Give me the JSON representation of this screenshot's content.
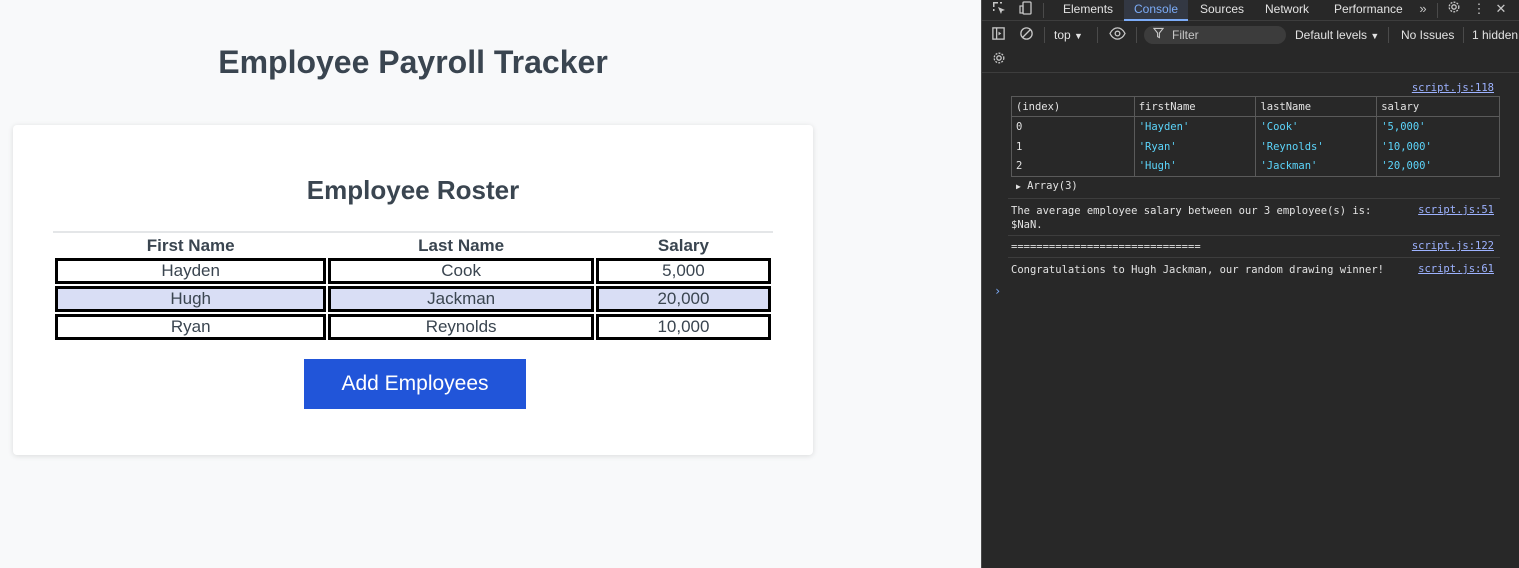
{
  "app": {
    "title": "Employee Payroll Tracker",
    "card_title": "Employee Roster",
    "table": {
      "headers": [
        "First Name",
        "Last Name",
        "Salary"
      ],
      "rows": [
        {
          "first": "Hayden",
          "last": "Cook",
          "salary": "5,000"
        },
        {
          "first": "Hugh",
          "last": "Jackman",
          "salary": "20,000"
        },
        {
          "first": "Ryan",
          "last": "Reynolds",
          "salary": "10,000"
        }
      ]
    },
    "add_button_label": "Add Employees"
  },
  "devtools": {
    "tabs": [
      "Elements",
      "Console",
      "Sources",
      "Network",
      "Performance"
    ],
    "active_tab": "Console",
    "more_tabs_icon": "chevron-double-right-icon",
    "toolbar": {
      "context": "top",
      "filter_placeholder": "Filter",
      "levels": "Default levels",
      "issues": "No Issues",
      "hidden": "1 hidden"
    },
    "console": {
      "table_source": "script.js:118",
      "table_headers": [
        "(index)",
        "firstName",
        "lastName",
        "salary"
      ],
      "table_rows": [
        [
          "0",
          "'Hayden'",
          "'Cook'",
          "'5,000'"
        ],
        [
          "1",
          "'Ryan'",
          "'Reynolds'",
          "'10,000'"
        ],
        [
          "2",
          "'Hugh'",
          "'Jackman'",
          "'20,000'"
        ]
      ],
      "array_label": "Array(3)",
      "avg_msg_line1": "The average employee salary between our 3 employee(s) is:",
      "avg_msg_line2": "$NaN.",
      "avg_source": "script.js:51",
      "separator": "==============================",
      "separator_source": "script.js:122",
      "winner_msg": "Congratulations to Hugh Jackman, our random drawing winner!",
      "winner_source": "script.js:61",
      "prompt": "›"
    },
    "colors": {
      "panel_bg": "#282828",
      "accent": "#7cacf8",
      "string": "#5cd5fb",
      "link": "#9db2ff"
    }
  }
}
